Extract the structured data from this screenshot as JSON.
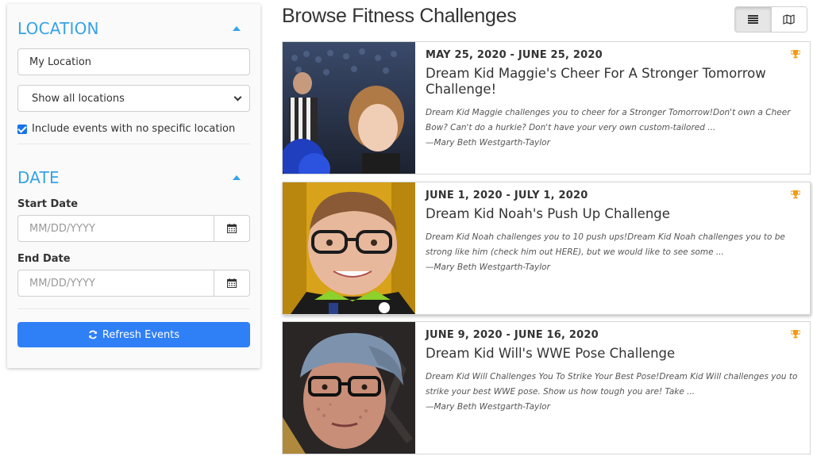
{
  "sidebar": {
    "location": {
      "title": "LOCATION",
      "input_value": "My Location",
      "select_value": "Show all locations",
      "checkbox_label": "Include events with no specific location"
    },
    "date": {
      "title": "DATE",
      "start_label": "Start Date",
      "start_placeholder": "MM/DD/YYYY",
      "end_label": "End Date",
      "end_placeholder": "MM/DD/YYYY"
    },
    "refresh_label": "Refresh Events"
  },
  "main": {
    "title": "Browse Fitness Challenges",
    "cards": [
      {
        "date": "MAY 25, 2020 - JUNE 25, 2020",
        "title": "Dream Kid Maggie's Cheer For A Stronger Tomorrow Challenge!",
        "desc": "Dream Kid Maggie challenges you to cheer for a Stronger Tomorrow!Don't own a Cheer Bow? Can't do a hurkie? Don't have your very own custom-tailored ...",
        "author": "—Mary Beth Westgarth-Taylor"
      },
      {
        "date": "JUNE 1, 2020 - JULY 1, 2020",
        "title": "Dream Kid Noah's Push Up Challenge",
        "desc": "Dream Kid Noah challenges you to 10 push ups!Dream Kid Noah challenges you to be strong like him (check him out HERE), but we would like to see some ...",
        "author": "—Mary Beth Westgarth-Taylor"
      },
      {
        "date": "JUNE 9, 2020 - JUNE 16, 2020",
        "title": "Dream Kid Will's WWE Pose Challenge",
        "desc": "Dream Kid Will Challenges You To Strike Your Best Pose!Dream Kid Will challenges you to strike your best WWE pose.  Show us how tough you are!  Take ...",
        "author": "—Mary Beth Westgarth-Taylor"
      }
    ]
  },
  "colors": {
    "accent": "#36a3e6",
    "button": "#2f7ff7",
    "trophy": "#f39c12"
  },
  "icons": [
    "caret-up-icon",
    "chevron-down-icon",
    "calendar-icon",
    "refresh-icon",
    "list-icon",
    "map-icon",
    "trophy-icon"
  ]
}
